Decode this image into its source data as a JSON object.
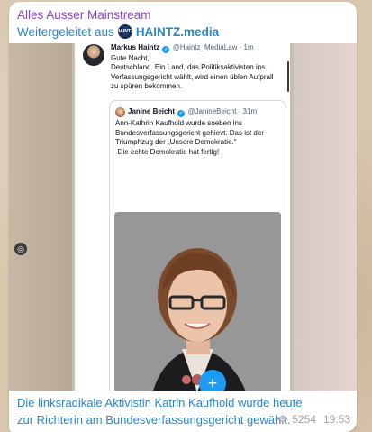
{
  "message": {
    "channel_name": "Alles Ausser Mainstream",
    "forwarded_prefix": "Weitergeleitet aus",
    "forwarded_source": "HAINTZ.media",
    "forwarded_avatar_text": "HAINTZ",
    "caption": "Die linksradikale Aktivistin Katrin Kaufhold wurde heute zur Richterin am Bundesverfassungsgericht gewählt.",
    "views": "5254",
    "time": "19:53"
  },
  "tweet": {
    "author": "Markus Haintz",
    "handle": "@Haintz_MediaLaw",
    "age": "· 1m",
    "text": "Gute Nacht,\nDeutschland. Ein Land, das Politiksaktivisten ins Verfassungsgericht wählt, wird einen üblen Aufprall zu spüren bekommen.",
    "quote": {
      "author": "Janine Beicht",
      "handle": "@JanineBeicht",
      "age": "· 31m",
      "text": "Ann-Kathrin Kaufhold wurde soeben ins Bundesverfassungsgericht gehievt. Das ist der Triumphzug der „Unsere Demokratie.“\n-Die echte Demokratie hat fertig!"
    }
  },
  "icons": {
    "verified": "verified-badge-icon",
    "views": "eye-icon",
    "compose": "plus-icon",
    "scan": "image-scan-icon"
  },
  "colors": {
    "channel_name": "#8b44c4",
    "link": "#2a86c9",
    "twitter_blue": "#1d9bf0",
    "muted": "#a4a4a4"
  }
}
